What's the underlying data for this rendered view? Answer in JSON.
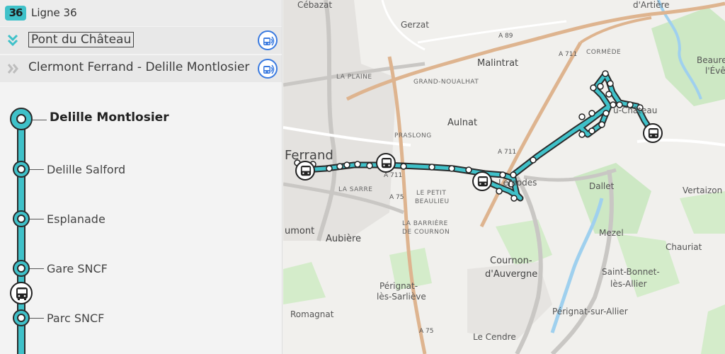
{
  "line": {
    "number": "36",
    "title": "Ligne 36",
    "color": "#3fc1c9"
  },
  "directions": [
    {
      "label": "Pont du Château",
      "chevron": "double-chevron-down-icon",
      "selected": true
    },
    {
      "label": "Clermont Ferrand - Delille Montlosier",
      "chevron": "double-chevron-right-icon",
      "selected": false
    }
  ],
  "stops": [
    {
      "label": "Delille Montlosier"
    },
    {
      "label": "Delille Salford"
    },
    {
      "label": "Esplanade"
    },
    {
      "label": "Gare SNCF"
    },
    {
      "label": "Parc SNCF"
    }
  ],
  "map": {
    "places": {
      "cebazat": "Cébazat",
      "gerzat": "Gerzat",
      "artiere": "d'Artière",
      "beaure": "Beaure",
      "leveque": "l'Évê",
      "cormede": "CORMÈDE",
      "malintrat": "Malintrat",
      "laplaine": "LA PLAINE",
      "grandnoualhat": "GRAND-NOUALHAT",
      "aulnat": "Aulnat",
      "praslong": "PRASLONG",
      "ferrand": "Ferrand",
      "pontchateau": "u-Château",
      "lempdes": "Lempdes",
      "dallet": "Dallet",
      "vertaizon": "Vertaizon",
      "lasarre": "LA SARRE",
      "petitbeaulieu1": "LE PETIT",
      "petitbeaulieu2": "BEAULIEU",
      "barriere1": "LA BARRIÈRE",
      "barriere2": "DE COURNON",
      "aubiere": "Aubière",
      "clermont": "umont",
      "mezel": "Mezel",
      "chauriat": "Chauriat",
      "cournon1": "Cournon-",
      "cournon2": "d'Auvergne",
      "stbonnet1": "Saint-Bonnet-",
      "stbonnet2": "lès-Allier",
      "perignat1": "Pérignat-",
      "perignat2": "lès-Sarliève",
      "romagnat": "Romagnat",
      "perignatallier": "Pérignat-sur-Allier",
      "lecendre": "Le Cendre"
    },
    "roads": {
      "a89": "A 89",
      "a711a": "A 711",
      "a711b": "A 711",
      "a711c": "A 711",
      "a75a": "A 75",
      "a75b": "A 75"
    }
  }
}
